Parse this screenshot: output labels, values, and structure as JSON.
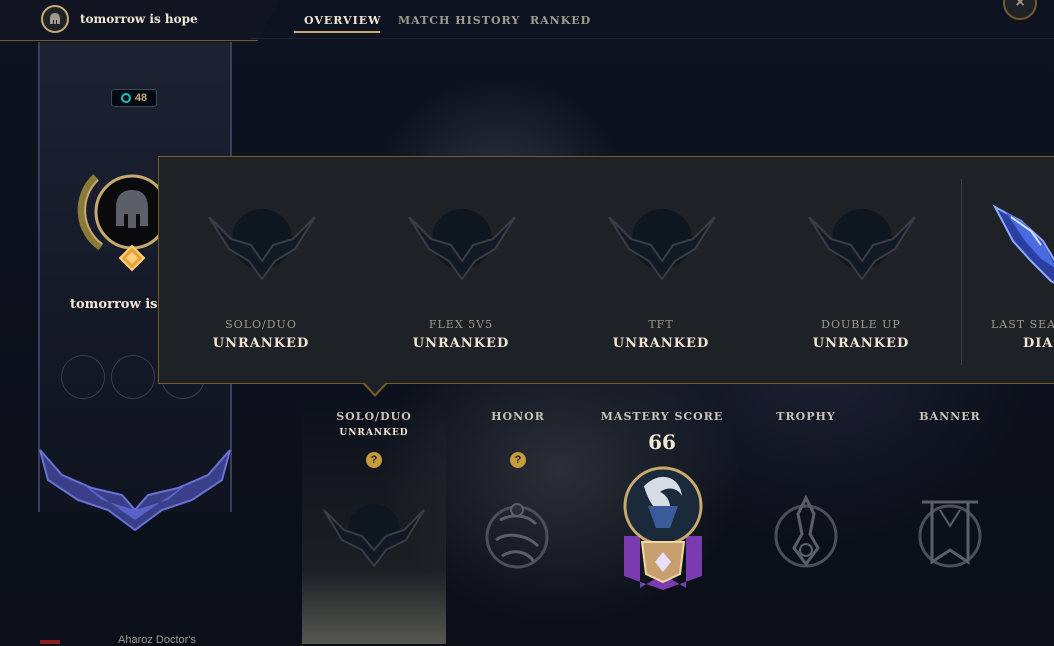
{
  "topbar": {
    "summoner_name": "tomorrow is hope",
    "tabs": [
      {
        "label": "OVERVIEW",
        "active": true
      },
      {
        "label": "MATCH HISTORY",
        "active": false
      },
      {
        "label": "RANKED",
        "active": false
      }
    ],
    "close_label": "×"
  },
  "profile": {
    "level": "48",
    "summoner_name": "tomorrow is hope"
  },
  "ranked_popup": {
    "queues": [
      {
        "label": "SOLO/DUO",
        "rank": "UNRANKED"
      },
      {
        "label": "FLEX 5V5",
        "rank": "UNRANKED"
      },
      {
        "label": "TFT",
        "rank": "UNRANKED"
      },
      {
        "label": "DOUBLE UP",
        "rank": "UNRANKED"
      }
    ],
    "last_season": {
      "label": "LAST SEASON",
      "rank": "DIAMOND"
    }
  },
  "showcase": {
    "solo": {
      "label": "SOLO/DUO",
      "sub": "UNRANKED",
      "help": "?"
    },
    "honor": {
      "label": "HONOR",
      "help": "?"
    },
    "mastery": {
      "label": "MASTERY SCORE",
      "score": "66"
    },
    "trophy": {
      "label": "TROPHY"
    },
    "banner": {
      "label": "BANNER"
    }
  },
  "footer": {
    "text": "Aharoz Doctor's "
  },
  "colors": {
    "gold": "#c8aa6e",
    "gold_dark": "#785a28",
    "text_light": "#f0e6d2",
    "text_muted": "#a09b8c",
    "help": "#c89b3c"
  }
}
